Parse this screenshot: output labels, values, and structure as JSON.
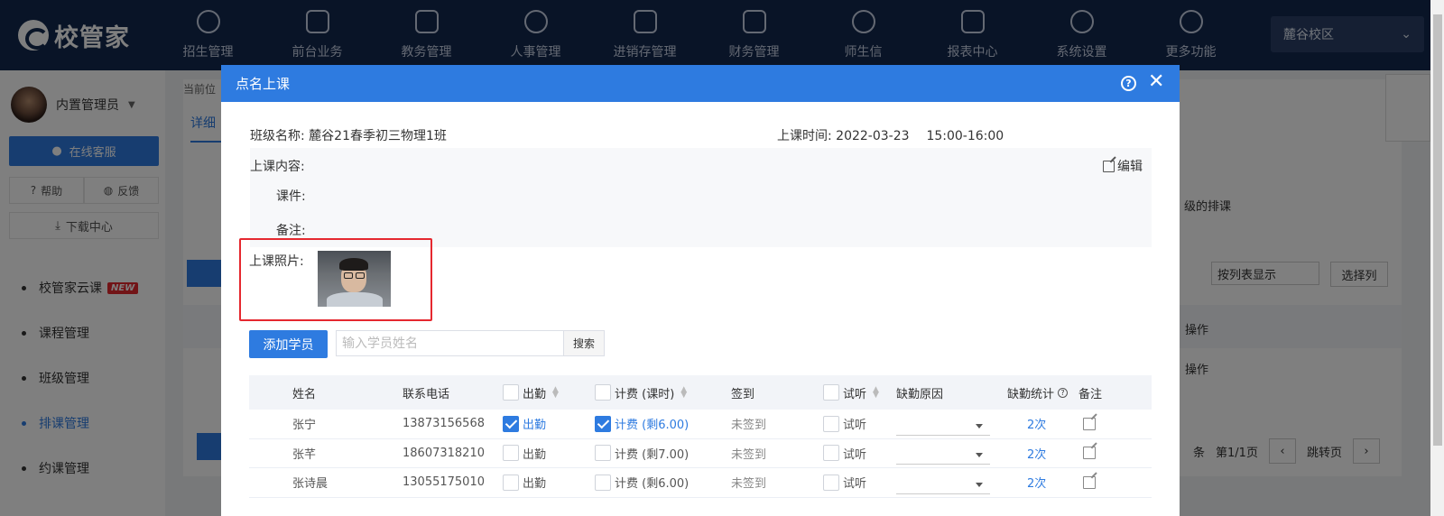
{
  "app": {
    "logo_text": "校管家",
    "nav": [
      {
        "label": "招生管理",
        "icon": "user-plus-icon"
      },
      {
        "label": "前台业务",
        "icon": "monitor-icon"
      },
      {
        "label": "教务管理",
        "icon": "book-icon"
      },
      {
        "label": "人事管理",
        "icon": "person-icon"
      },
      {
        "label": "进销存管理",
        "icon": "exchange-icon"
      },
      {
        "label": "财务管理",
        "icon": "money-icon"
      },
      {
        "label": "师生信",
        "icon": "chat-icon"
      },
      {
        "label": "报表中心",
        "icon": "report-icon"
      },
      {
        "label": "系统设置",
        "icon": "settings-icon"
      },
      {
        "label": "更多功能",
        "icon": "more-icon"
      }
    ],
    "campus": "麓谷校区"
  },
  "sidebar": {
    "user_name": "内置管理员",
    "online_service": "在线客服",
    "help": "帮助",
    "feedback": "反馈",
    "download": "下载中心",
    "menu": [
      {
        "label": "校管家云课",
        "badge": "NEW"
      },
      {
        "label": "课程管理"
      },
      {
        "label": "班级管理"
      },
      {
        "label": "排课管理",
        "active": true
      },
      {
        "label": "约课管理"
      }
    ]
  },
  "background": {
    "breadcrumb": "当前位",
    "tab": "详细",
    "right_text": "级的排课",
    "select_display": "按列表显示",
    "select_column": "选择列",
    "op1": "操作",
    "op2": "操作",
    "pager_unit": "条",
    "pager_page": "第1/1页",
    "pager_jump": "跳转页"
  },
  "modal": {
    "title": "点名上课",
    "class_label": "班级名称:",
    "class_name": "麓谷21春季初三物理1班",
    "time_label": "上课时间:",
    "date": "2022-03-23",
    "time": "15:00-16:00",
    "content_label": "上课内容:",
    "edit": "编辑",
    "courseware_label": "课件:",
    "remark_label": "备注:",
    "photo_label": "上课照片:",
    "add_student": "添加学员",
    "search_placeholder": "输入学员姓名",
    "search": "搜索",
    "columns": {
      "name": "姓名",
      "phone": "联系电话",
      "attend": "出勤",
      "fee": "计费 (课时)",
      "signin": "签到",
      "trial": "试听",
      "absence_reason": "缺勤原因",
      "absence_stat": "缺勤统计",
      "note": "备注"
    },
    "rows": [
      {
        "name": "张宁",
        "phone": "13873156568",
        "attend_label": "出勤",
        "attend": true,
        "fee_label": "计费 (剩6.00)",
        "fee": true,
        "signin": "未签到",
        "trial_label": "试听",
        "absence_count": "2次"
      },
      {
        "name": "张芊",
        "phone": "18607318210",
        "attend_label": "出勤",
        "attend": false,
        "fee_label": "计费 (剩7.00)",
        "fee": false,
        "signin": "未签到",
        "trial_label": "试听",
        "absence_count": "2次"
      },
      {
        "name": "张诗晨",
        "phone": "13055175010",
        "attend_label": "出勤",
        "attend": false,
        "fee_label": "计费 (剩6.00)",
        "fee": false,
        "signin": "未签到",
        "trial_label": "试听",
        "absence_count": "2次"
      }
    ]
  }
}
